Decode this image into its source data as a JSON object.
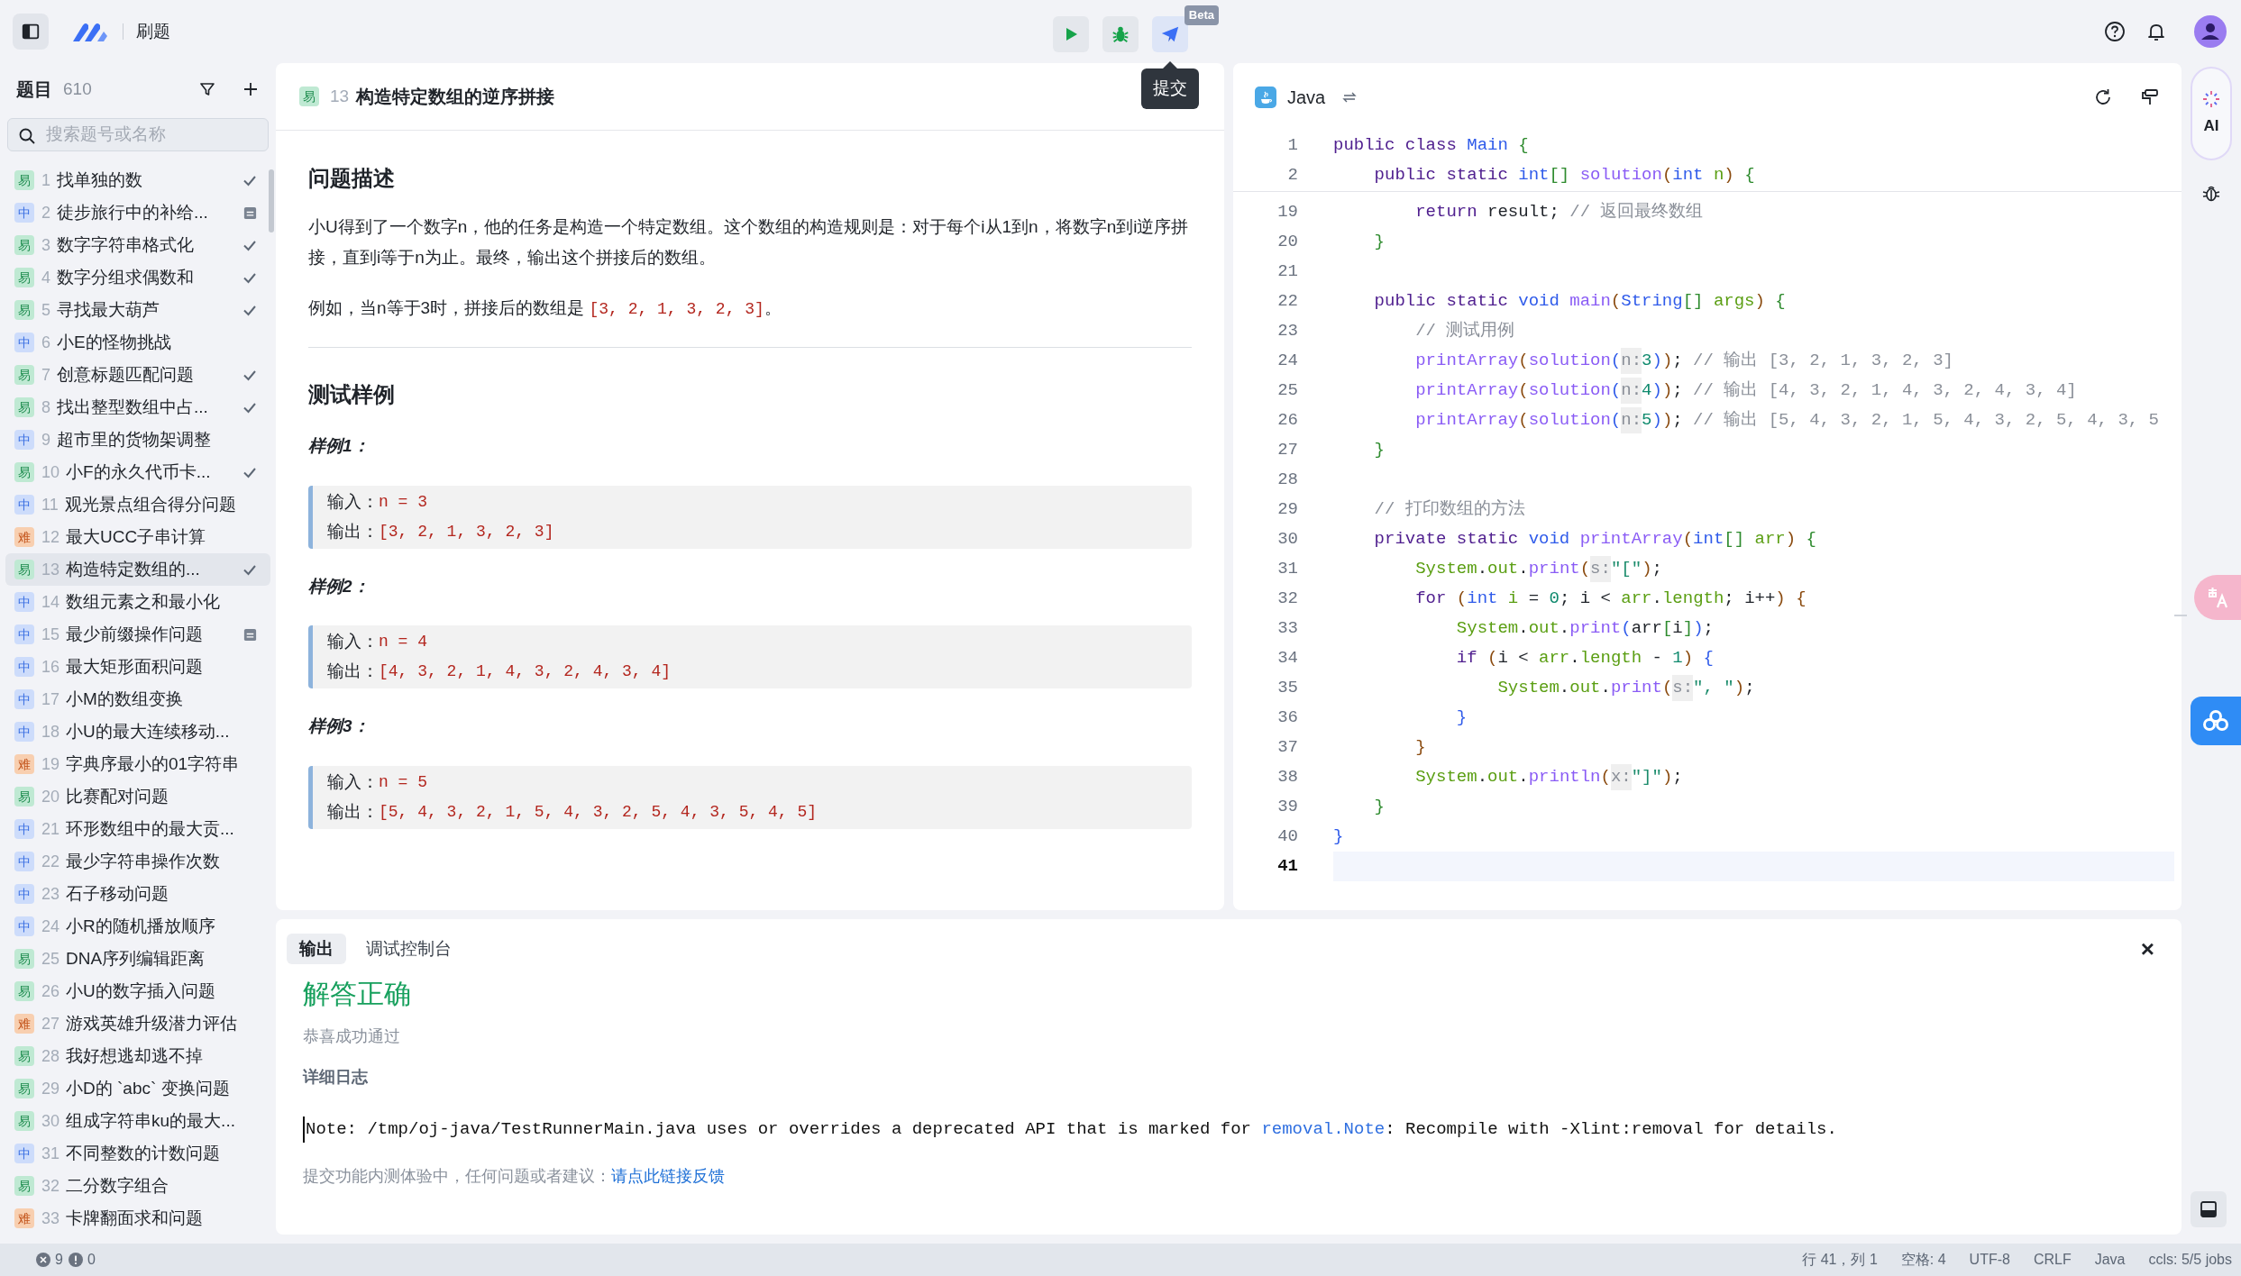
{
  "topbar": {
    "app_title": "刷题",
    "tools": [
      {
        "kind": "run"
      },
      {
        "kind": "debug"
      },
      {
        "kind": "submit"
      }
    ],
    "beta_badge": "Beta",
    "tooltip": "提交"
  },
  "sidebar": {
    "title": "题目",
    "count": "610",
    "search": {
      "placeholder": "搜索题号或名称"
    },
    "problems": [
      {
        "badge": "易",
        "kind": "easy",
        "number": "1",
        "title": "找单独的数",
        "solved": true,
        "draft": false,
        "selected": false
      },
      {
        "badge": "中",
        "kind": "medium",
        "number": "2",
        "title": "徒步旅行中的补给...",
        "solved": false,
        "draft": true,
        "selected": false
      },
      {
        "badge": "易",
        "kind": "easy",
        "number": "3",
        "title": "数字字符串格式化",
        "solved": true,
        "draft": false,
        "selected": false
      },
      {
        "badge": "易",
        "kind": "easy",
        "number": "4",
        "title": "数字分组求偶数和",
        "solved": true,
        "draft": false,
        "selected": false
      },
      {
        "badge": "易",
        "kind": "easy",
        "number": "5",
        "title": "寻找最大葫芦",
        "solved": true,
        "draft": false,
        "selected": false
      },
      {
        "badge": "中",
        "kind": "medium",
        "number": "6",
        "title": "小E的怪物挑战",
        "solved": false,
        "draft": false,
        "selected": false
      },
      {
        "badge": "易",
        "kind": "easy",
        "number": "7",
        "title": "创意标题匹配问题",
        "solved": true,
        "draft": false,
        "selected": false
      },
      {
        "badge": "易",
        "kind": "easy",
        "number": "8",
        "title": "找出整型数组中占...",
        "solved": true,
        "draft": false,
        "selected": false
      },
      {
        "badge": "中",
        "kind": "medium",
        "number": "9",
        "title": "超市里的货物架调整",
        "solved": false,
        "draft": false,
        "selected": false
      },
      {
        "badge": "易",
        "kind": "easy",
        "number": "10",
        "title": "小F的永久代币卡...",
        "solved": true,
        "draft": false,
        "selected": false
      },
      {
        "badge": "中",
        "kind": "medium",
        "number": "11",
        "title": "观光景点组合得分问题",
        "solved": false,
        "draft": false,
        "selected": false
      },
      {
        "badge": "难",
        "kind": "hard",
        "number": "12",
        "title": "最大UCC子串计算",
        "solved": false,
        "draft": false,
        "selected": false
      },
      {
        "badge": "易",
        "kind": "easy",
        "number": "13",
        "title": "构造特定数组的...",
        "solved": true,
        "draft": false,
        "selected": true
      },
      {
        "badge": "中",
        "kind": "medium",
        "number": "14",
        "title": "数组元素之和最小化",
        "solved": false,
        "draft": false,
        "selected": false
      },
      {
        "badge": "中",
        "kind": "medium",
        "number": "15",
        "title": "最少前缀操作问题",
        "solved": false,
        "draft": true,
        "selected": false
      },
      {
        "badge": "中",
        "kind": "medium",
        "number": "16",
        "title": "最大矩形面积问题",
        "solved": false,
        "draft": false,
        "selected": false
      },
      {
        "badge": "中",
        "kind": "medium",
        "number": "17",
        "title": "小M的数组变换",
        "solved": false,
        "draft": false,
        "selected": false
      },
      {
        "badge": "中",
        "kind": "medium",
        "number": "18",
        "title": "小U的最大连续移动...",
        "solved": false,
        "draft": false,
        "selected": false
      },
      {
        "badge": "难",
        "kind": "hard",
        "number": "19",
        "title": "字典序最小的01字符串",
        "solved": false,
        "draft": false,
        "selected": false
      },
      {
        "badge": "易",
        "kind": "easy",
        "number": "20",
        "title": "比赛配对问题",
        "solved": false,
        "draft": false,
        "selected": false
      },
      {
        "badge": "中",
        "kind": "medium",
        "number": "21",
        "title": "环形数组中的最大贡...",
        "solved": false,
        "draft": false,
        "selected": false
      },
      {
        "badge": "中",
        "kind": "medium",
        "number": "22",
        "title": "最少字符串操作次数",
        "solved": false,
        "draft": false,
        "selected": false
      },
      {
        "badge": "中",
        "kind": "medium",
        "number": "23",
        "title": "石子移动问题",
        "solved": false,
        "draft": false,
        "selected": false
      },
      {
        "badge": "中",
        "kind": "medium",
        "number": "24",
        "title": "小R的随机播放顺序",
        "solved": false,
        "draft": false,
        "selected": false
      },
      {
        "badge": "易",
        "kind": "easy",
        "number": "25",
        "title": "DNA序列编辑距离",
        "solved": false,
        "draft": false,
        "selected": false
      },
      {
        "badge": "易",
        "kind": "easy",
        "number": "26",
        "title": "小U的数字插入问题",
        "solved": false,
        "draft": false,
        "selected": false
      },
      {
        "badge": "难",
        "kind": "hard",
        "number": "27",
        "title": "游戏英雄升级潜力评估",
        "solved": false,
        "draft": false,
        "selected": false
      },
      {
        "badge": "易",
        "kind": "easy",
        "number": "28",
        "title": "我好想逃却逃不掉",
        "solved": false,
        "draft": false,
        "selected": false
      },
      {
        "badge": "易",
        "kind": "easy",
        "number": "29",
        "title": "小D的 `abc` 变换问题",
        "solved": false,
        "draft": false,
        "selected": false
      },
      {
        "badge": "易",
        "kind": "easy",
        "number": "30",
        "title": "组成字符串ku的最大...",
        "solved": false,
        "draft": false,
        "selected": false
      },
      {
        "badge": "中",
        "kind": "medium",
        "number": "31",
        "title": "不同整数的计数问题",
        "solved": false,
        "draft": false,
        "selected": false
      },
      {
        "badge": "易",
        "kind": "easy",
        "number": "32",
        "title": "二分数字组合",
        "solved": false,
        "draft": false,
        "selected": false
      },
      {
        "badge": "难",
        "kind": "hard",
        "number": "33",
        "title": "卡牌翻面求和问题",
        "solved": false,
        "draft": false,
        "selected": false
      }
    ]
  },
  "problem": {
    "badge": "易",
    "kind": "easy",
    "number": "13",
    "title": "构造特定数组的逆序拼接",
    "description": {
      "heading": "问题描述",
      "paragraphs": [
        [
          {
            "kind": "text",
            "text": "小U得到了一个数字n，他的任务是构造一个特定数组。这个数组的构造规则是：对于每个i从1到n，将数字n到i逆序拼接，直到i等于n为止。最终，输出这个拼接后的数组。"
          }
        ],
        [
          {
            "kind": "text",
            "text": "例如，当n等于3时，拼接后的数组是 "
          },
          {
            "kind": "code",
            "text": "[3, 2, 1, 3, 2, 3]"
          },
          {
            "kind": "text",
            "text": "。"
          }
        ]
      ]
    },
    "samples": {
      "heading": "测试样例",
      "items": [
        {
          "title": "样例1：",
          "input_label": "输入：",
          "input": "n = 3",
          "output_label": "输出：",
          "output": "[3, 2, 1, 3, 2, 3]"
        },
        {
          "title": "样例2：",
          "input_label": "输入：",
          "input": "n = 4",
          "output_label": "输出：",
          "output": "[4, 3, 2, 1, 4, 3, 2, 4, 3, 4]"
        },
        {
          "title": "样例3：",
          "input_label": "输入：",
          "input": "n = 5",
          "output_label": "输出：",
          "output": "[5, 4, 3, 2, 1, 5, 4, 3, 2, 5, 4, 3, 5, 4, 5]"
        }
      ]
    }
  },
  "editor": {
    "language": "Java",
    "sticky_lines": [
      {
        "number": "1",
        "tokens": [
          {
            "kind": "kw",
            "text": "public class "
          },
          {
            "kind": "type",
            "text": "Main "
          },
          {
            "kind": "brace",
            "text": "{"
          }
        ]
      },
      {
        "number": "2",
        "tokens": [
          {
            "kind": "kw",
            "text": "    public static "
          },
          {
            "kind": "type",
            "text": "int"
          },
          {
            "kind": "brace",
            "text": "[] "
          },
          {
            "kind": "fn",
            "text": "solution"
          },
          {
            "kind": "paren",
            "text": "("
          },
          {
            "kind": "type",
            "text": "int "
          },
          {
            "kind": "var",
            "text": "n"
          },
          {
            "kind": "paren",
            "text": ") "
          },
          {
            "kind": "brace",
            "text": "{"
          }
        ]
      }
    ],
    "lines": [
      {
        "number": "19",
        "current": false,
        "tokens": [
          {
            "kind": "kw",
            "text": "        return "
          },
          {
            "kind": "plain",
            "text": "result; "
          },
          {
            "kind": "comment",
            "text": "// 返回最终数组"
          }
        ]
      },
      {
        "number": "20",
        "current": false,
        "tokens": [
          {
            "kind": "brace",
            "text": "    }"
          }
        ]
      },
      {
        "number": "21",
        "current": false
      },
      {
        "number": "22",
        "current": false,
        "tokens": [
          {
            "kind": "kw",
            "text": "    public static "
          },
          {
            "kind": "type",
            "text": "void "
          },
          {
            "kind": "fn",
            "text": "main"
          },
          {
            "kind": "paren",
            "text": "("
          },
          {
            "kind": "type",
            "text": "String"
          },
          {
            "kind": "brace",
            "text": "[] "
          },
          {
            "kind": "var",
            "text": "args"
          },
          {
            "kind": "paren",
            "text": ") "
          },
          {
            "kind": "brace",
            "text": "{"
          }
        ]
      },
      {
        "number": "23",
        "current": false,
        "tokens": [
          {
            "kind": "comment",
            "text": "        // 测试用例"
          }
        ]
      },
      {
        "number": "24",
        "current": false,
        "tokens": [
          {
            "kind": "fn",
            "text": "        printArray"
          },
          {
            "kind": "paren",
            "text": "("
          },
          {
            "kind": "fn",
            "text": "solution"
          },
          {
            "kind": "bracket",
            "text": "("
          },
          {
            "kind": "hint",
            "text": "n:"
          },
          {
            "kind": "num",
            "text": "3"
          },
          {
            "kind": "bracket",
            "text": ")"
          },
          {
            "kind": "paren",
            "text": ")"
          },
          {
            "kind": "plain",
            "text": "; "
          },
          {
            "kind": "comment",
            "text": "// 输出 [3, 2, 1, 3, 2, 3]"
          }
        ]
      },
      {
        "number": "25",
        "current": false,
        "tokens": [
          {
            "kind": "fn",
            "text": "        printArray"
          },
          {
            "kind": "paren",
            "text": "("
          },
          {
            "kind": "fn",
            "text": "solution"
          },
          {
            "kind": "bracket",
            "text": "("
          },
          {
            "kind": "hint",
            "text": "n:"
          },
          {
            "kind": "num",
            "text": "4"
          },
          {
            "kind": "bracket",
            "text": ")"
          },
          {
            "kind": "paren",
            "text": ")"
          },
          {
            "kind": "plain",
            "text": "; "
          },
          {
            "kind": "comment",
            "text": "// 输出 [4, 3, 2, 1, 4, 3, 2, 4, 3, 4]"
          }
        ]
      },
      {
        "number": "26",
        "current": false,
        "tokens": [
          {
            "kind": "fn",
            "text": "        printArray"
          },
          {
            "kind": "paren",
            "text": "("
          },
          {
            "kind": "fn",
            "text": "solution"
          },
          {
            "kind": "bracket",
            "text": "("
          },
          {
            "kind": "hint",
            "text": "n:"
          },
          {
            "kind": "num",
            "text": "5"
          },
          {
            "kind": "bracket",
            "text": ")"
          },
          {
            "kind": "paren",
            "text": ")"
          },
          {
            "kind": "plain",
            "text": "; "
          },
          {
            "kind": "comment",
            "text": "// 输出 [5, 4, 3, 2, 1, 5, 4, 3, 2, 5, 4, 3, 5"
          }
        ]
      },
      {
        "number": "27",
        "current": false,
        "tokens": [
          {
            "kind": "brace",
            "text": "    }"
          }
        ]
      },
      {
        "number": "28",
        "current": false
      },
      {
        "number": "29",
        "current": false,
        "tokens": [
          {
            "kind": "comment",
            "text": "    // 打印数组的方法"
          }
        ]
      },
      {
        "number": "30",
        "current": false,
        "tokens": [
          {
            "kind": "kw",
            "text": "    private static "
          },
          {
            "kind": "type",
            "text": "void "
          },
          {
            "kind": "fn",
            "text": "printArray"
          },
          {
            "kind": "paren",
            "text": "("
          },
          {
            "kind": "type",
            "text": "int"
          },
          {
            "kind": "brace",
            "text": "[] "
          },
          {
            "kind": "var",
            "text": "arr"
          },
          {
            "kind": "paren",
            "text": ") "
          },
          {
            "kind": "brace",
            "text": "{"
          }
        ]
      },
      {
        "number": "31",
        "current": false,
        "tokens": [
          {
            "kind": "var",
            "text": "        System"
          },
          {
            "kind": "plain",
            "text": "."
          },
          {
            "kind": "var",
            "text": "out"
          },
          {
            "kind": "plain",
            "text": "."
          },
          {
            "kind": "fn",
            "text": "print"
          },
          {
            "kind": "paren",
            "text": "("
          },
          {
            "kind": "hint",
            "text": "s:"
          },
          {
            "kind": "str",
            "text": "\"[\""
          },
          {
            "kind": "paren",
            "text": ")"
          },
          {
            "kind": "plain",
            "text": ";"
          }
        ]
      },
      {
        "number": "32",
        "current": false,
        "tokens": [
          {
            "kind": "kw",
            "text": "        for "
          },
          {
            "kind": "paren",
            "text": "("
          },
          {
            "kind": "type",
            "text": "int "
          },
          {
            "kind": "var",
            "text": "i"
          },
          {
            "kind": "plain",
            "text": " = "
          },
          {
            "kind": "num",
            "text": "0"
          },
          {
            "kind": "plain",
            "text": "; i < "
          },
          {
            "kind": "var",
            "text": "arr"
          },
          {
            "kind": "plain",
            "text": "."
          },
          {
            "kind": "var",
            "text": "length"
          },
          {
            "kind": "plain",
            "text": "; i++"
          },
          {
            "kind": "paren",
            "text": ") {"
          }
        ]
      },
      {
        "number": "33",
        "current": false,
        "tokens": [
          {
            "kind": "var",
            "text": "            System"
          },
          {
            "kind": "plain",
            "text": "."
          },
          {
            "kind": "var",
            "text": "out"
          },
          {
            "kind": "plain",
            "text": "."
          },
          {
            "kind": "fn",
            "text": "print"
          },
          {
            "kind": "bracket",
            "text": "("
          },
          {
            "kind": "plain",
            "text": "arr"
          },
          {
            "kind": "brace",
            "text": "["
          },
          {
            "kind": "plain",
            "text": "i"
          },
          {
            "kind": "brace",
            "text": "]"
          },
          {
            "kind": "bracket",
            "text": ")"
          },
          {
            "kind": "plain",
            "text": ";"
          }
        ]
      },
      {
        "number": "34",
        "current": false,
        "tokens": [
          {
            "kind": "kw",
            "text": "            if "
          },
          {
            "kind": "paren",
            "text": "("
          },
          {
            "kind": "plain",
            "text": "i < "
          },
          {
            "kind": "var",
            "text": "arr"
          },
          {
            "kind": "plain",
            "text": "."
          },
          {
            "kind": "var",
            "text": "length"
          },
          {
            "kind": "plain",
            "text": " - "
          },
          {
            "kind": "num",
            "text": "1"
          },
          {
            "kind": "paren",
            "text": ") "
          },
          {
            "kind": "bracket",
            "text": "{"
          }
        ]
      },
      {
        "number": "35",
        "current": false,
        "tokens": [
          {
            "kind": "var",
            "text": "                System"
          },
          {
            "kind": "plain",
            "text": "."
          },
          {
            "kind": "var",
            "text": "out"
          },
          {
            "kind": "plain",
            "text": "."
          },
          {
            "kind": "fn",
            "text": "print"
          },
          {
            "kind": "paren",
            "text": "("
          },
          {
            "kind": "hint",
            "text": "s:"
          },
          {
            "kind": "str",
            "text": "\", \""
          },
          {
            "kind": "paren",
            "text": ")"
          },
          {
            "kind": "plain",
            "text": ";"
          }
        ]
      },
      {
        "number": "36",
        "current": false,
        "tokens": [
          {
            "kind": "bracket",
            "text": "            }"
          }
        ]
      },
      {
        "number": "37",
        "current": false,
        "tokens": [
          {
            "kind": "paren",
            "text": "        }"
          }
        ]
      },
      {
        "number": "38",
        "current": false,
        "tokens": [
          {
            "kind": "var",
            "text": "        System"
          },
          {
            "kind": "plain",
            "text": "."
          },
          {
            "kind": "var",
            "text": "out"
          },
          {
            "kind": "plain",
            "text": "."
          },
          {
            "kind": "fn",
            "text": "println"
          },
          {
            "kind": "paren",
            "text": "("
          },
          {
            "kind": "hint",
            "text": "x:"
          },
          {
            "kind": "str",
            "text": "\"]\""
          },
          {
            "kind": "paren",
            "text": ")"
          },
          {
            "kind": "plain",
            "text": ";"
          }
        ]
      },
      {
        "number": "39",
        "current": false,
        "tokens": [
          {
            "kind": "brace",
            "text": "    }"
          }
        ]
      },
      {
        "number": "40",
        "current": false,
        "tokens": [
          {
            "kind": "bracket",
            "text": "}"
          }
        ]
      },
      {
        "number": "41",
        "current": true
      }
    ]
  },
  "right_rail": {
    "ai_label": "AI"
  },
  "output": {
    "tabs": [
      {
        "label": "输出",
        "selected": true
      },
      {
        "label": "调试控制台",
        "selected": false
      }
    ],
    "close": "×",
    "verdict": "解答正确",
    "subtitle": "恭喜成功通过",
    "log_heading": "详细日志",
    "log": [
      {
        "kind": "text",
        "text": "Note: /tmp/oj-java/TestRunnerMain.java uses or overrides a deprecated API that is marked for "
      },
      {
        "kind": "link",
        "text": "removal.Note"
      },
      {
        "kind": "text",
        "text": ": Recompile with -Xlint:removal for details."
      }
    ],
    "feedback": "提交功能内测体验中，任何问题或者建议：",
    "feedback_link": "请点此链接反馈"
  },
  "status_bar": {
    "errors": "9",
    "warnings": "0",
    "items": [
      "行 41，列 1",
      "空格: 4",
      "UTF-8",
      "CRLF",
      "Java",
      "ccls: 5/5 jobs"
    ]
  }
}
